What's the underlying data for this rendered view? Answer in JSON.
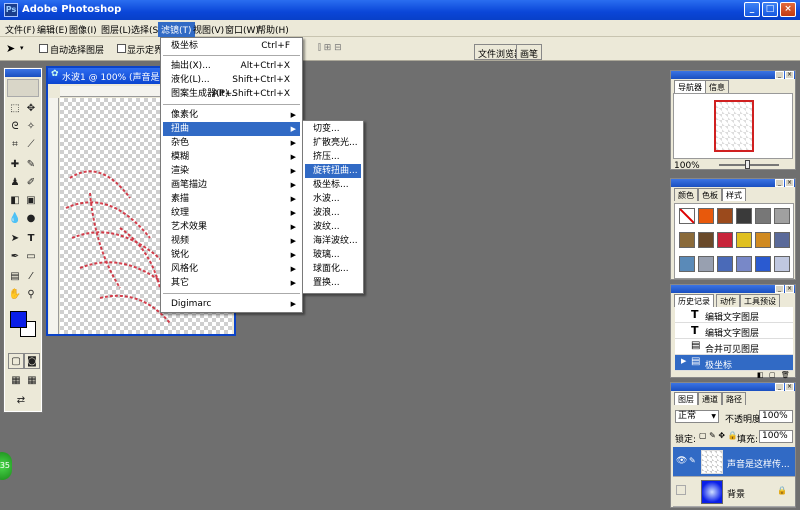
{
  "app": {
    "title": "Adobe Photoshop",
    "icon": "photoshop-icon"
  },
  "window_buttons": {
    "minimize": "_",
    "maximize": "□",
    "close": "×"
  },
  "menubar": [
    {
      "label": "文件(F)"
    },
    {
      "label": "编辑(E)"
    },
    {
      "label": "图像(I)"
    },
    {
      "label": "图层(L)"
    },
    {
      "label": "选择(S)"
    },
    {
      "label": "滤镜(T)"
    },
    {
      "label": "视图(V)"
    },
    {
      "label": "窗口(W)"
    },
    {
      "label": "帮助(H)"
    }
  ],
  "options": {
    "auto_select": "自动选择图层",
    "show_bounds": "显示定界框"
  },
  "file_tabs": {
    "browser": "文件浏览器",
    "brushes": "画笔"
  },
  "document": {
    "title": "水波1 @ 100% (声音是这"
  },
  "filter_menu": {
    "top": [
      {
        "label": "极坐标",
        "shortcut": "Ctrl+F"
      }
    ],
    "group2": [
      {
        "label": "抽出(X)...",
        "shortcut": "Alt+Ctrl+X"
      },
      {
        "label": "液化(L)...",
        "shortcut": "Shift+Ctrl+X"
      },
      {
        "label": "图案生成器(P)...",
        "shortcut": "Alt+Shift+Ctrl+X"
      }
    ],
    "group3": [
      {
        "label": "像素化"
      },
      {
        "label": "扭曲"
      },
      {
        "label": "杂色"
      },
      {
        "label": "模糊"
      },
      {
        "label": "渲染"
      },
      {
        "label": "画笔描边"
      },
      {
        "label": "素描"
      },
      {
        "label": "纹理"
      },
      {
        "label": "艺术效果"
      },
      {
        "label": "视频"
      },
      {
        "label": "锐化"
      },
      {
        "label": "风格化"
      },
      {
        "label": "其它"
      }
    ],
    "group4": [
      {
        "label": "Digimarc"
      }
    ]
  },
  "distort_menu": [
    {
      "label": "切变..."
    },
    {
      "label": "扩散亮光..."
    },
    {
      "label": "挤压..."
    },
    {
      "label": "旋转扭曲..."
    },
    {
      "label": "极坐标..."
    },
    {
      "label": "水波..."
    },
    {
      "label": "波浪..."
    },
    {
      "label": "波纹..."
    },
    {
      "label": "海洋波纹..."
    },
    {
      "label": "玻璃..."
    },
    {
      "label": "球面化..."
    },
    {
      "label": "置换..."
    }
  ],
  "navigator": {
    "tabs": [
      "导航器",
      "信息"
    ],
    "zoom": "100%"
  },
  "color_panel": {
    "tabs": [
      "颜色",
      "色板",
      "样式"
    ],
    "swatches": [
      "#ffffff",
      "#e8590c",
      "#9b4a1c",
      "#3a3a3a",
      "#777777",
      "#a0a0a0",
      "#8a6a3a",
      "#6a4a2a",
      "#c8243a",
      "#e0c020",
      "#d08a20",
      "#5a6a9a",
      "#5a8ab8",
      "#98a0b0",
      "#4a6ab8",
      "#7888c8",
      "#2a5ad0",
      "#c0c8e0"
    ]
  },
  "history": {
    "tabs": [
      "历史记录",
      "动作",
      "工具预设"
    ],
    "items": [
      {
        "label": "编辑文字图层",
        "icon": "text-tool-icon"
      },
      {
        "label": "编辑文字图层",
        "icon": "text-tool-icon"
      },
      {
        "label": "合并可见图层",
        "icon": "document-icon"
      },
      {
        "label": "极坐标",
        "icon": "document-icon"
      }
    ]
  },
  "layers": {
    "tabs": [
      "图层",
      "通道",
      "路径"
    ],
    "blend_mode": "正常",
    "opacity_label": "不透明度:",
    "opacity": "100%",
    "lock_label": "锁定:",
    "fill_label": "填充:",
    "fill": "100%",
    "items": [
      {
        "name": "声音是这样传..."
      },
      {
        "name": "背景"
      }
    ]
  },
  "taskbar": {
    "badge": "35"
  },
  "colors": {
    "foreground": "#0a1fe8",
    "background": "#ffffff",
    "menu_highlight": "#316ac5"
  }
}
